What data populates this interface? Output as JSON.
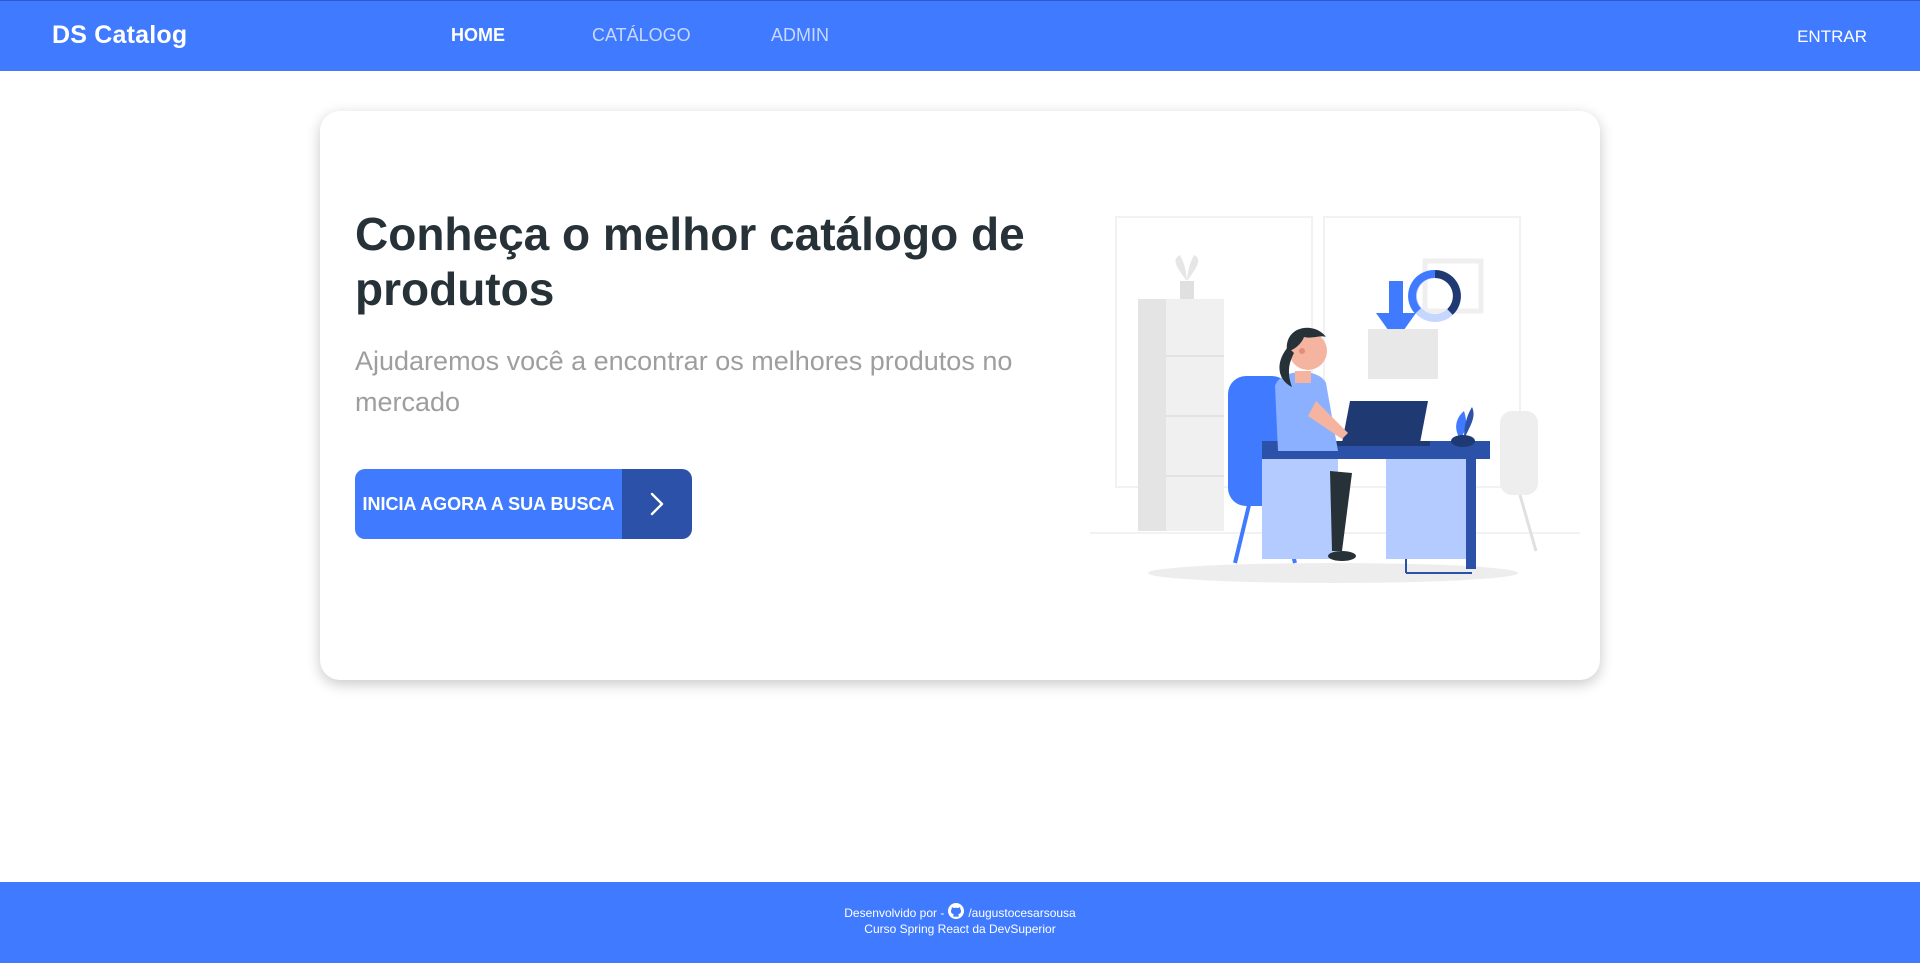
{
  "navbar": {
    "brand": "DS Catalog",
    "links": [
      {
        "label": "HOME",
        "active": true
      },
      {
        "label": "CATÁLOGO",
        "active": false
      },
      {
        "label": "ADMIN",
        "active": false
      }
    ],
    "login_label": "ENTRAR"
  },
  "hero": {
    "title": "Conheça o melhor catálogo de produtos",
    "subtitle": "Ajudaremos você a encontrar os melhores produtos no mercado",
    "cta_label": "INICIA AGORA A SUA BUSCA",
    "cta_icon": "chevron-right-icon",
    "illustration": "woman-working-at-desk-illustration"
  },
  "footer": {
    "developed_by_prefix": "Desenvolvido por - ",
    "github_icon": "github-icon",
    "github_handle": "/augustocesarsousa",
    "course": "Curso Spring React da DevSuperior"
  },
  "colors": {
    "primary": "#407bff",
    "primary_dark": "#2c51a8",
    "title_text": "#263238",
    "subtitle_text": "#9e9e9e"
  }
}
